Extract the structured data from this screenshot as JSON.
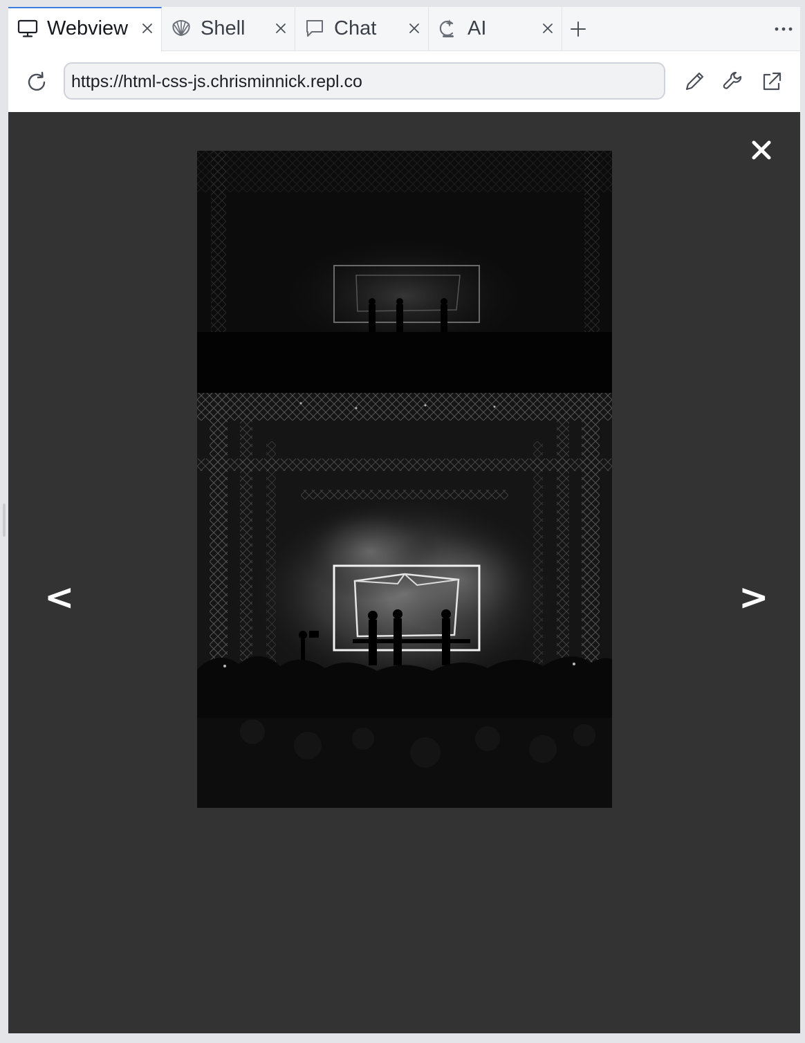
{
  "tabs": [
    {
      "label": "Webview",
      "icon": "monitor-icon",
      "active": true
    },
    {
      "label": "Shell",
      "icon": "shell-icon",
      "active": false
    },
    {
      "label": "Chat",
      "icon": "chat-bubble-icon",
      "active": false
    },
    {
      "label": "AI",
      "icon": "ai-sparkle-icon",
      "active": false
    }
  ],
  "address_bar": {
    "url": "https://html-css-js.chrisminnick.repl.co"
  },
  "lightbox": {
    "prev_label": "<",
    "next_label": ">",
    "close_icon": "close-icon",
    "image_description_icon": "concert-photo"
  },
  "colors": {
    "active_tab_accent": "#3c7ee0",
    "overlay_background": "#333333"
  }
}
